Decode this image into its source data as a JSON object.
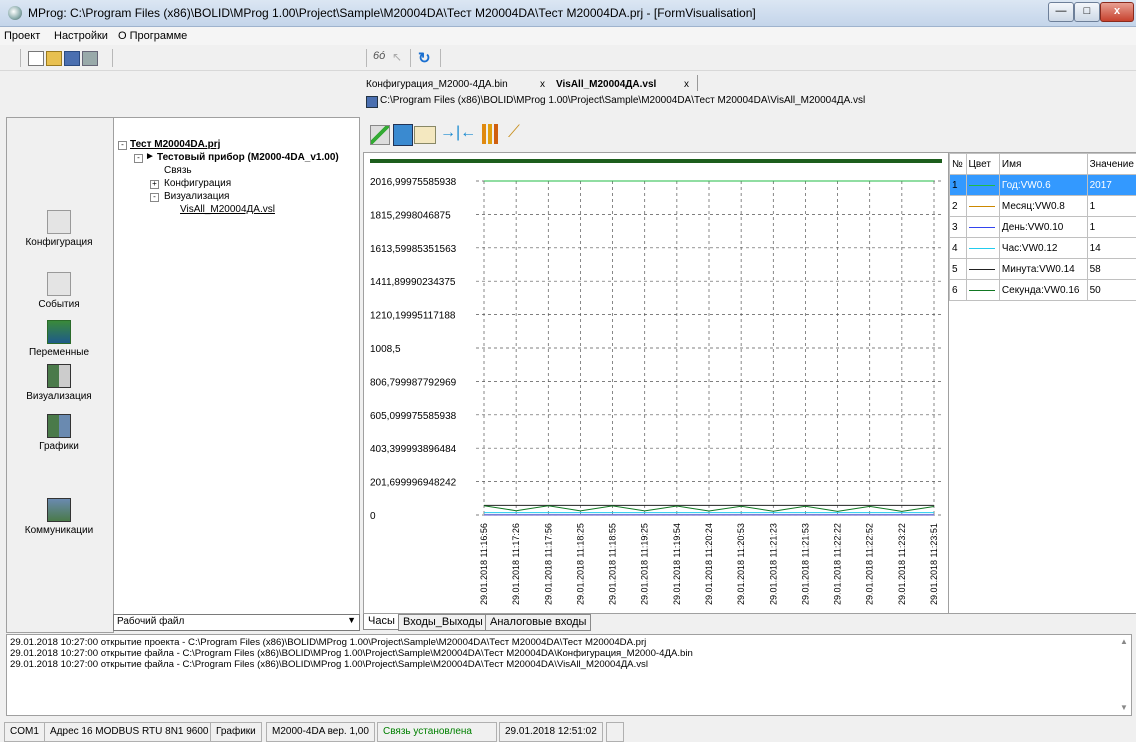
{
  "window": {
    "title": "MProg: C:\\Program Files (x86)\\BOLID\\MProg 1.00\\Project\\Sample\\M20004DA\\Тест M20004DA\\Тест M20004DA.prj - [FormVisualisation]",
    "minimize": "—",
    "maximize": "□",
    "close": "x"
  },
  "menu": [
    "Проект",
    "Настройки",
    "О Программе"
  ],
  "doc_tabs": [
    {
      "label": "Конфигурация_M2000-4ДА.bin",
      "close": "x"
    },
    {
      "label": "VisAll_M20004ДА.vsl",
      "close": "x"
    }
  ],
  "file_path": "C:\\Program Files (x86)\\BOLID\\MProg 1.00\\Project\\Sample\\M20004DA\\Тест M20004DA\\VisAll_M20004ДА.vsl",
  "nav": [
    {
      "label": "Конфигурация",
      "icon": "configuration-icon"
    },
    {
      "label": "События",
      "icon": "events-icon"
    },
    {
      "label": "Переменные",
      "icon": "variables-icon"
    },
    {
      "label": "Визуализация",
      "icon": "visualization-icon"
    },
    {
      "label": "Графики",
      "icon": "charts-icon"
    },
    {
      "label": "Коммуникации",
      "icon": "communications-icon"
    }
  ],
  "tree": {
    "root": "Тест M20004DA.prj",
    "device": "Тестовый прибор (M2000-4DA_v1.00)",
    "children": [
      "Связь",
      "Конфигурация",
      "Визуализация"
    ],
    "file": "VisAll_M20004ДА.vsl",
    "selector": "Рабочий файл"
  },
  "bottom_tabs": [
    "Часы",
    "Входы_Выходы",
    "Аналоговые входы"
  ],
  "legend": {
    "headers": [
      "№",
      "Цвет",
      "Имя",
      "Значение"
    ],
    "rows": [
      {
        "n": "1",
        "name": "Год:VW0.6",
        "value": "2017",
        "color": "#22bb44"
      },
      {
        "n": "2",
        "name": "Месяц:VW0.8",
        "value": "1",
        "color": "#cc8800"
      },
      {
        "n": "3",
        "name": "День:VW0.10",
        "value": "1",
        "color": "#3344ee"
      },
      {
        "n": "4",
        "name": "Час:VW0.12",
        "value": "14",
        "color": "#22ccee"
      },
      {
        "n": "5",
        "name": "Минута:VW0.14",
        "value": "58",
        "color": "#222222"
      },
      {
        "n": "6",
        "name": "Секунда:VW0.16",
        "value": "50",
        "color": "#117722"
      }
    ]
  },
  "chart_data": {
    "type": "line",
    "y_ticks": [
      "2016,99975585938",
      "1815,2998046875",
      "1613,59985351563",
      "1411,89990234375",
      "1210,19995117188",
      "1008,5",
      "806,799987792969",
      "605,099975585938",
      "403,399993896484",
      "201,699996948242",
      "0"
    ],
    "ylim": [
      0,
      2017
    ],
    "x_ticks": [
      "29.01.2018 11:16:56",
      "29.01.2018 11:17:26",
      "29.01.2018 11:17:56",
      "29.01.2018 11:18:25",
      "29.01.2018 11:18:55",
      "29.01.2018 11:19:25",
      "29.01.2018 11:19:54",
      "29.01.2018 11:20:24",
      "29.01.2018 11:20:53",
      "29.01.2018 11:21:23",
      "29.01.2018 11:21:53",
      "29.01.2018 11:22:22",
      "29.01.2018 11:22:52",
      "29.01.2018 11:23:22",
      "29.01.2018 11:23:51"
    ],
    "grid": true,
    "series": [
      {
        "name": "Год:VW0.6",
        "color": "#22bb44",
        "values": [
          2017,
          2017,
          2017,
          2017,
          2017,
          2017,
          2017,
          2017,
          2017,
          2017,
          2017,
          2017,
          2017,
          2017,
          2017
        ]
      },
      {
        "name": "Месяц:VW0.8",
        "color": "#cc8800",
        "values": [
          1,
          1,
          1,
          1,
          1,
          1,
          1,
          1,
          1,
          1,
          1,
          1,
          1,
          1,
          1
        ]
      },
      {
        "name": "День:VW0.10",
        "color": "#3344ee",
        "values": [
          1,
          1,
          1,
          1,
          1,
          1,
          1,
          1,
          1,
          1,
          1,
          1,
          1,
          1,
          1
        ]
      },
      {
        "name": "Час:VW0.12",
        "color": "#22ccee",
        "values": [
          14,
          14,
          14,
          14,
          14,
          14,
          14,
          14,
          14,
          14,
          14,
          14,
          14,
          14,
          14
        ]
      },
      {
        "name": "Минута:VW0.14",
        "color": "#222222",
        "values": [
          58,
          58,
          58,
          58,
          58,
          58,
          58,
          58,
          58,
          58,
          58,
          58,
          58,
          58,
          58
        ]
      },
      {
        "name": "Секунда:VW0.16",
        "color": "#117722",
        "values": [
          56,
          26,
          56,
          25,
          55,
          25,
          54,
          24,
          53,
          23,
          53,
          22,
          52,
          22,
          51
        ]
      }
    ]
  },
  "log": [
    "29.01.2018 10:27:00 открытие проекта - C:\\Program Files (x86)\\BOLID\\MProg 1.00\\Project\\Sample\\M20004DA\\Тест M20004DA\\Тест M20004DA.prj",
    "29.01.2018 10:27:00 открытие файла - C:\\Program Files (x86)\\BOLID\\MProg 1.00\\Project\\Sample\\M20004DA\\Тест M20004DA\\Конфигурация_M2000-4ДА.bin",
    "29.01.2018 10:27:00 открытие файла - C:\\Program Files (x86)\\BOLID\\MProg 1.00\\Project\\Sample\\M20004DA\\Тест M20004DA\\VisAll_M20004ДА.vsl"
  ],
  "status": {
    "port": "COM1",
    "address": "Адрес 16 MODBUS RTU 8N1 9600",
    "mode": "Графики",
    "device": "M2000-4DA вер. 1,00",
    "connection": "Связь установлена",
    "datetime": "29.01.2018 12:51:02",
    "connection_color": "#008000"
  }
}
